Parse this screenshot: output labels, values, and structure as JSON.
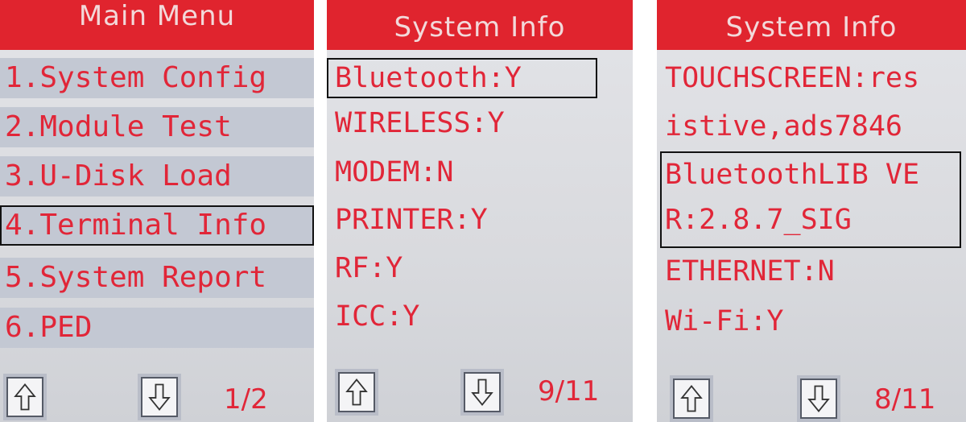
{
  "screens": [
    {
      "title": "Main Menu",
      "items": [
        "1.System Config",
        "2.Module Test",
        "3.U-Disk Load",
        "4.Terminal Info",
        "5.System Report",
        "6.PED"
      ],
      "page": "1/2"
    },
    {
      "title": "System Info",
      "items": [
        "Bluetooth:Y",
        "WIRELESS:Y",
        "MODEM:N",
        "PRINTER:Y",
        "RF:Y",
        "ICC:Y"
      ],
      "page": "9/11"
    },
    {
      "title": "System Info",
      "items": [
        "TOUCHSCREEN:res",
        "istive,ads7846",
        "BluetoothLIB VE",
        "R:2.8.7_SIG",
        "ETHERNET:N",
        "Wi-Fi:Y"
      ],
      "page": "8/11"
    }
  ],
  "colors": {
    "header": "#e0242e",
    "text": "#e12638",
    "background": "#dcdde1"
  },
  "icons": {
    "up": "up-arrow-icon",
    "down": "down-arrow-icon"
  }
}
